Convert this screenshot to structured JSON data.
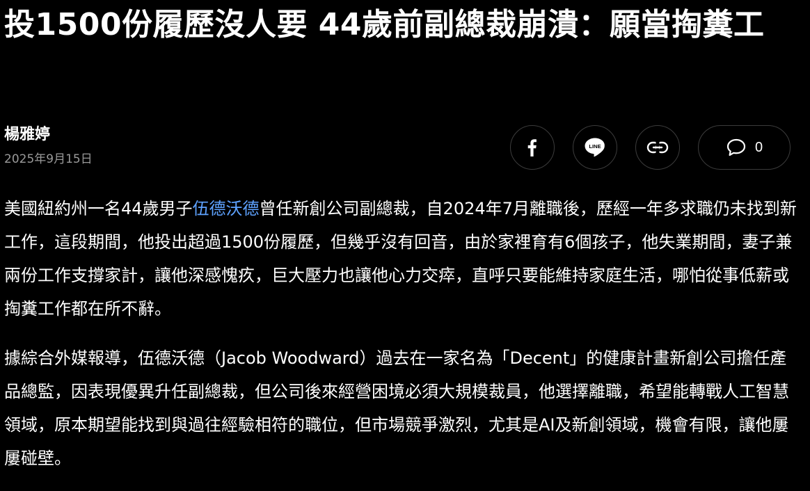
{
  "article": {
    "headline": "投1500份履歷沒人要 44歲前副總裁崩潰：願當掏糞工",
    "author": "楊雅婷",
    "date": "2025年9月15日",
    "comment_count": "0",
    "share_icons": [
      "facebook-icon",
      "line-icon",
      "link-icon",
      "comment-icon"
    ],
    "paragraphs": [
      {
        "before": "美國紐約州一名44歲男子",
        "link": "伍德沃德",
        "after": "曾任新創公司副總裁，自2024年7月離職後，歷經一年多求職仍未找到新工作，這段期間，他投出超過1500份履歷，但幾乎沒有回音，由於家裡育有6個孩子，他失業期間，妻子兼兩份工作支撐家計，讓他深感愧疚，巨大壓力也讓他心力交瘁，直呼只要能維持家庭生活，哪怕從事低薪或掏糞工作都在所不辭。"
      },
      {
        "text": "據綜合外媒報導，伍德沃德（Jacob Woodward）過去在一家名為「Decent」的健康計畫新創公司擔任產品總監，因表現優異升任副總裁，但公司後來經營困境必須大規模裁員，他選擇離職，希望能轉戰人工智慧領域，原本期望能找到與過往經驗相符的職位，但市場競爭激烈，尤其是AI及新創領域，機會有限，讓他屢屢碰壁。"
      }
    ]
  },
  "colors": {
    "background": "#000000",
    "text": "#ffffff",
    "link": "#5ea2ff",
    "date": "#9a9a9a",
    "button_border": "#3c3c3c"
  }
}
